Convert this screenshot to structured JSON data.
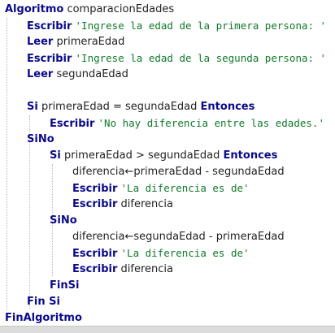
{
  "colors": {
    "keyword": "#0a0a8a",
    "string": "#0f7a2a",
    "identifier": "#222222",
    "background": "#ffffff",
    "status_bar": "#dcdcdc"
  },
  "code": {
    "l1_kw": "Algoritmo",
    "l1_name": "comparacionEdades",
    "l2_kw": "Escribir",
    "l2_str": "'Ingrese la edad de la primera persona: '",
    "l3_kw": "Leer",
    "l3_var": "primeraEdad",
    "l4_kw": "Escribir",
    "l4_str": "'Ingrese la edad de la segunda persona: '",
    "l5_kw": "Leer",
    "l5_var": "segundaEdad",
    "l7_kw": "Si",
    "l7_cond": "primeraEdad = segundaEdad",
    "l7_kw2": "Entonces",
    "l8_kw": "Escribir",
    "l8_str": "'No hay diferencia entre las edades.'",
    "l9_kw": "SiNo",
    "l10_kw": "Si",
    "l10_cond": "primeraEdad > segundaEdad",
    "l10_kw2": "Entonces",
    "l11_expr": "diferencia←primeraEdad - segundaEdad",
    "l12_kw": "Escribir",
    "l12_str": "'La diferencia es de'",
    "l13_kw": "Escribir",
    "l13_var": "diferencia",
    "l14_kw": "SiNo",
    "l15_expr": "diferencia←segundaEdad - primeraEdad",
    "l16_kw": "Escribir",
    "l16_str": "'La diferencia es de'",
    "l17_kw": "Escribir",
    "l17_var": "diferencia",
    "l18_kw": "FinSi",
    "l19_kw": "Fin Si",
    "l20_kw": "FinAlgoritmo"
  }
}
